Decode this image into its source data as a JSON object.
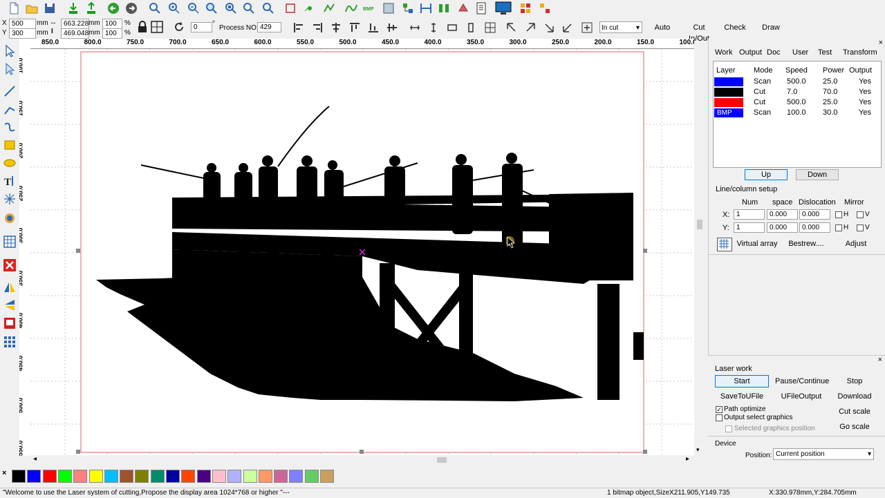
{
  "toolbar": {
    "x_label": "X",
    "x_value": "500",
    "y_label": "Y",
    "y_value": "300",
    "unit_mm": "mm",
    "width_value": "663.228",
    "height_value": "469.048",
    "scale_x": "100",
    "scale_y": "100",
    "percent": "%",
    "rotation_value": "0",
    "degree": "°",
    "process_label": "Process NO:",
    "process_value": "429",
    "cut_mode": "In cut",
    "auto_label": "Auto",
    "cut_inout_label": "Cut In/Out",
    "check_label": "Check",
    "draw_label": "Draw"
  },
  "hruler": [
    "850.0",
    "800.0",
    "750.0",
    "700.0",
    "650.0",
    "600.0",
    "550.0",
    "500.0",
    "450.0",
    "400.0",
    "350.0",
    "300.0",
    "250.0",
    "200.0",
    "150.0",
    "100.0"
  ],
  "vruler": [
    "100.0",
    "150.0",
    "200.0",
    "250.0",
    "300.0",
    "350.0",
    "400.0",
    "450.0",
    "500.0",
    "550.0"
  ],
  "panel": {
    "tabs": [
      "Work",
      "Output",
      "Doc",
      "User",
      "Test",
      "Transform"
    ],
    "headers": [
      "Layer",
      "Mode",
      "Speed",
      "Power",
      "Output"
    ],
    "layers": [
      {
        "color": "#0000ff",
        "name": "",
        "mode": "Scan",
        "speed": "500.0",
        "power": "25.0",
        "output": "Yes"
      },
      {
        "color": "#000000",
        "name": "",
        "mode": "Cut",
        "speed": "7.0",
        "power": "70.0",
        "output": "Yes"
      },
      {
        "color": "#ff0000",
        "name": "",
        "mode": "Cut",
        "speed": "500.0",
        "power": "25.0",
        "output": "Yes"
      },
      {
        "color": "#0000ff",
        "name": "BMP",
        "mode": "Scan",
        "speed": "100.0",
        "power": "30.0",
        "output": "Yes"
      }
    ],
    "up_label": "Up",
    "down_label": "Down",
    "linecol_title": "Line/column setup",
    "col_num": "Num",
    "col_space": "space",
    "col_dislocation": "Dislocation",
    "col_mirror": "Mirror",
    "x_label": "X:",
    "y_label": "Y:",
    "x_num": "1",
    "x_space": "0.000",
    "x_dis": "0.000",
    "y_num": "1",
    "y_space": "0.000",
    "y_dis": "0.000",
    "h_label": "H",
    "v_label": "V",
    "virtual_array": "Virtual array",
    "bestrew": "Bestrew....",
    "adjust": "Adjust"
  },
  "laserwork": {
    "title": "Laser work",
    "start": "Start",
    "pause": "Pause/Continue",
    "stop": "Stop",
    "save_file": "SaveToUFile",
    "ufile_output": "UFileOutput",
    "download": "Download",
    "path_optimize": "Path optimize",
    "output_select": "Output select graphics",
    "selected_pos": "Selected graphics position",
    "cut_scale": "Cut scale",
    "go_scale": "Go scale",
    "device_title": "Device",
    "position_label": "Position:",
    "position_value": "Current position"
  },
  "palette": [
    "#000000",
    "#0000ff",
    "#ff0000",
    "#00ff00",
    "#ff8080",
    "#ffff00",
    "#00bfff",
    "#a0522d",
    "#808000",
    "#008b6b",
    "#0000a0",
    "#ff4500",
    "#4b0082",
    "#ffc0cb",
    "#b0b0ff",
    "#ccffa0",
    "#ff9966",
    "#cc6699",
    "#8080ff",
    "#66cc66",
    "#c8a060"
  ],
  "status": {
    "message": "\"Welcome to use the Laser system of cutting,Propose the display area 1024*768 or higher \"---",
    "selection": "1 bitmap object,SizeX211.905,Y149.735",
    "coords": "X:330.978mm,Y:284.705mm"
  }
}
